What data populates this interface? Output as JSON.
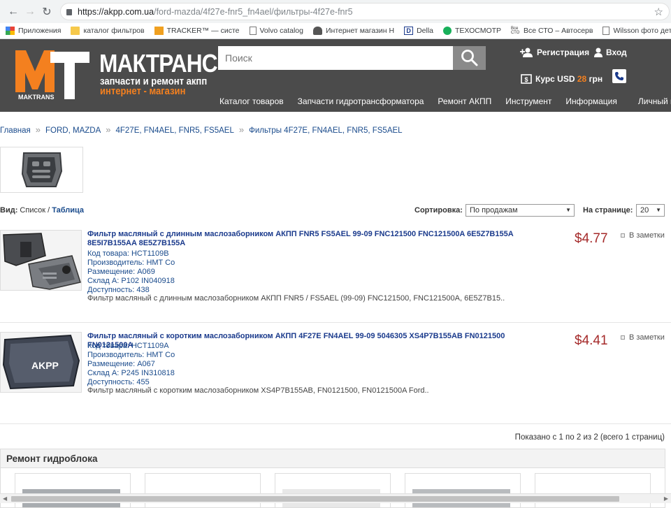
{
  "browser": {
    "url_host": "https://akpp.com.ua",
    "url_path": "/ford-mazda/4f27e-fnr5_fn4ael/фильтры-4f27e-fnr5",
    "bookmarks": [
      {
        "label": "Приложения",
        "icon": "apps-grid-icon"
      },
      {
        "label": "каталог фильтров",
        "icon": "folder-icon"
      },
      {
        "label": "TRACKER™ — систе",
        "icon": "tracker-icon"
      },
      {
        "label": "Volvo catalog",
        "icon": "page-icon"
      },
      {
        "label": "Интернет магазин Н",
        "icon": "car-icon"
      },
      {
        "label": "Della",
        "icon": "della-icon"
      },
      {
        "label": "ТЕХОСМОТР",
        "icon": "green-circle-icon"
      },
      {
        "label": "Все СТО – Автосерв",
        "icon": "sto-icon"
      },
      {
        "label": "Wilsson фото детале",
        "icon": "page-icon"
      }
    ]
  },
  "header": {
    "logo_name": "МАКТРАНС",
    "logo_sub1": "запчасти и ремонт акпп",
    "logo_sub2": "интернет - магазин",
    "logo_badge": "MAKTRANS",
    "search_placeholder": "Поиск",
    "register": "Регистрация",
    "login": "Вход",
    "rate_prefix": "Курс USD",
    "rate_value": "28",
    "rate_suffix": "грн",
    "colors": {
      "bg": "#4b4b4b",
      "accent": "#f4801f"
    },
    "nav": [
      "Каталог товаров",
      "Запчасти гидротрансформатора",
      "Ремонт АКПП",
      "Инструмент",
      "Информация",
      "Личный кабинет"
    ]
  },
  "breadcrumb": [
    "Главная",
    "FORD, MAZDA",
    "4F27E, FN4AEL, FNR5, FS5AEL",
    "Фильтры 4F27E, FN4AEL, FNR5, FS5AEL"
  ],
  "listing": {
    "view_label": "Вид:",
    "view_list": "Список",
    "view_sep": " / ",
    "view_table": "Таблица",
    "sort_label": "Сортировка:",
    "sort_value": "По продажам",
    "perpage_label": "На странице:",
    "perpage_value": "20"
  },
  "products": [
    {
      "title": "Фильтр масляный с длинным маслозаборником АКПП FNR5 FS5AEL 99-09 FNC121500 FNC121500A 6E5Z7B155A 8E5I7B155AA 8E5Z7B155A",
      "code_label": "Код товара:",
      "code": "HCT1109B",
      "maker_label": "Производитель:",
      "maker": "HMT Co",
      "place_label": "Размещение:",
      "place": "A069",
      "stock_label": "Склад А:",
      "stock": "P102 IN040918",
      "avail_label": "Доступность:",
      "avail": "438",
      "desc": "Фильтр масляный с длинным маслозаборником АКПП FNR5 / FS5AEL (99-09) FNC121500, FNC121500A, 6E5Z7B15..",
      "price": "$4.77",
      "wish": "В заметки"
    },
    {
      "title": "Фильтр масляный с коротким маслозаборником АКПП 4F27E FN4AEL 99-09 5046305 XS4P7B155AB FN0121500 FN0121500A",
      "code_label": "Код товара:",
      "code": "HCT1109A",
      "maker_label": "Производитель:",
      "maker": "HMT Co",
      "place_label": "Размещение:",
      "place": "A067",
      "stock_label": "Склад А:",
      "stock": "P245 IN310818",
      "avail_label": "Доступность:",
      "avail": "455",
      "desc": "Фильтр масляный с коротким маслозаборником  XS4P7B155AB, FN0121500, FN0121500A  Ford..",
      "price": "$4.41",
      "wish": "В заметки",
      "img_text": "AKPP"
    }
  ],
  "pagination": "Показано с 1 по 2 из 2 (всего 1 страниц)",
  "repair": {
    "title": "Ремонт гидроблока"
  }
}
